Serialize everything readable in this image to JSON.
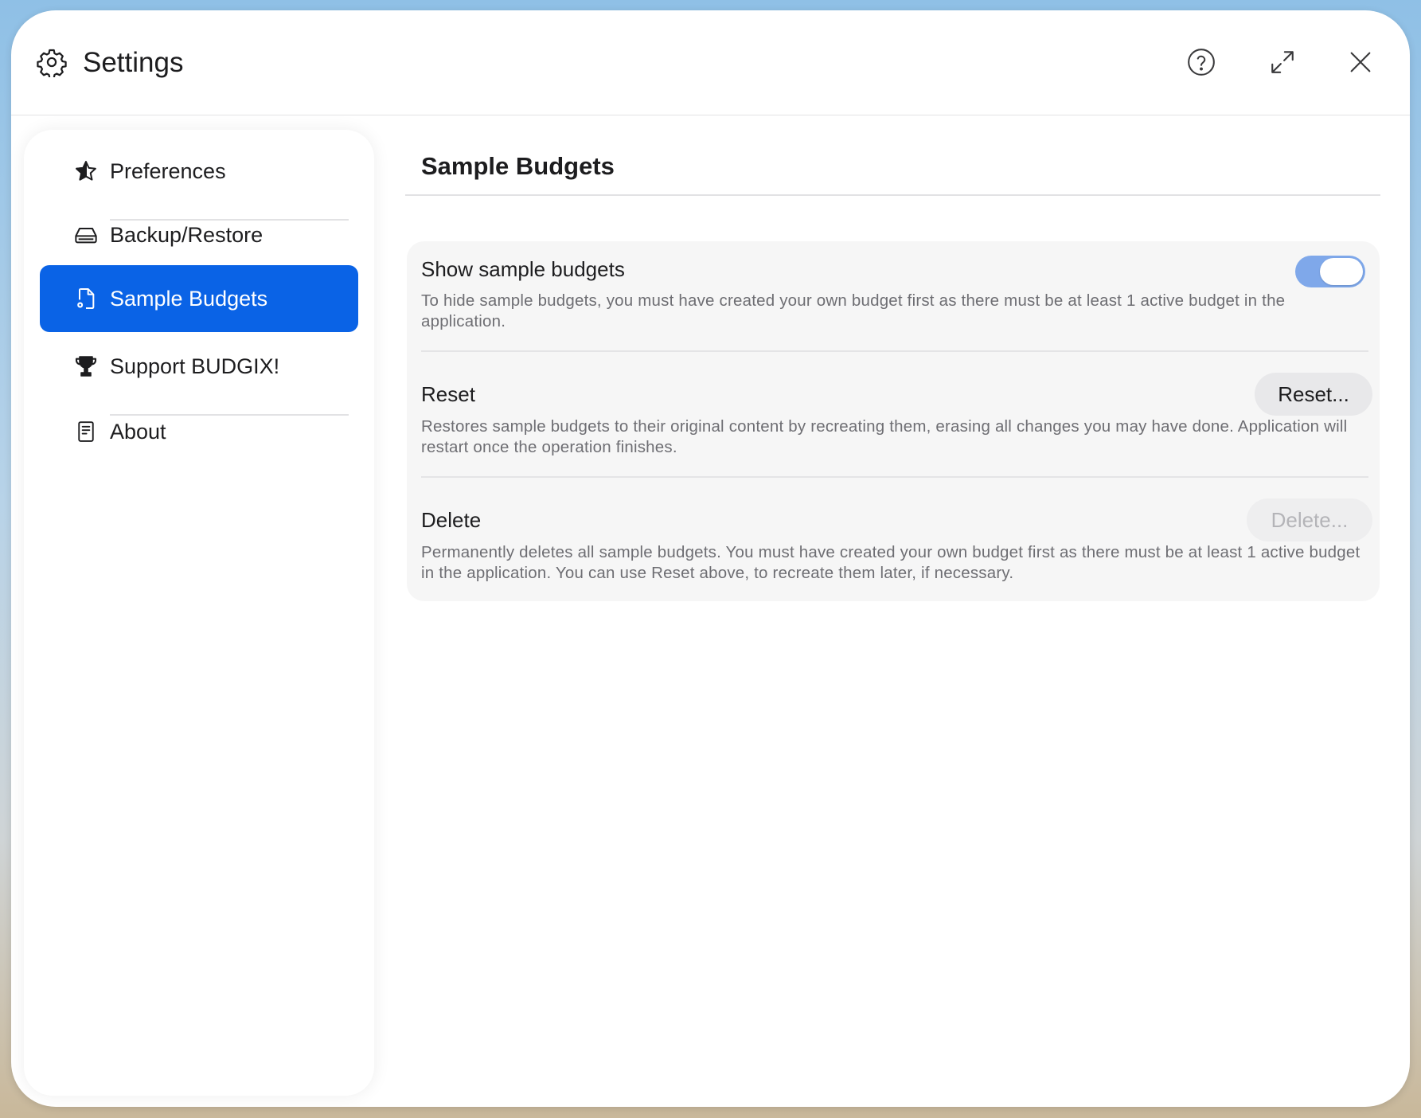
{
  "window": {
    "title": "Settings",
    "help_icon": "question-circle-icon",
    "expand_icon": "expand-icon",
    "close_icon": "close-icon"
  },
  "sidebar": {
    "items": [
      {
        "label": "Preferences",
        "icon": "star-icon",
        "active": false
      },
      {
        "label": "Backup/Restore",
        "icon": "drive-icon",
        "active": false
      },
      {
        "label": "Sample Budgets",
        "icon": "sample-document-icon",
        "active": true
      },
      {
        "label": "Support BUDGIX!",
        "icon": "trophy-icon",
        "active": false
      },
      {
        "label": "About",
        "icon": "document-icon",
        "active": false
      }
    ]
  },
  "main": {
    "title": "Sample Budgets",
    "show": {
      "title": "Show sample budgets",
      "description": "To hide sample budgets, you must have created your own budget first as there must be at least 1 active budget in the application.",
      "enabled": true
    },
    "reset": {
      "title": "Reset",
      "button_label": "Reset...",
      "description": "Restores sample budgets to their original content by recreating them, erasing all changes you may have done. Application will restart once the operation finishes."
    },
    "delete": {
      "title": "Delete",
      "button_label": "Delete...",
      "button_disabled": true,
      "description": "Permanently deletes all sample budgets. You must have created your own budget first as there must be at least 1 active budget in the application. You can use Reset above, to recreate them later, if necessary."
    }
  },
  "colors": {
    "accent": "#0a63e6",
    "toggle_on": "#7fa8ea",
    "disabled_text": "#b4b4b8"
  }
}
